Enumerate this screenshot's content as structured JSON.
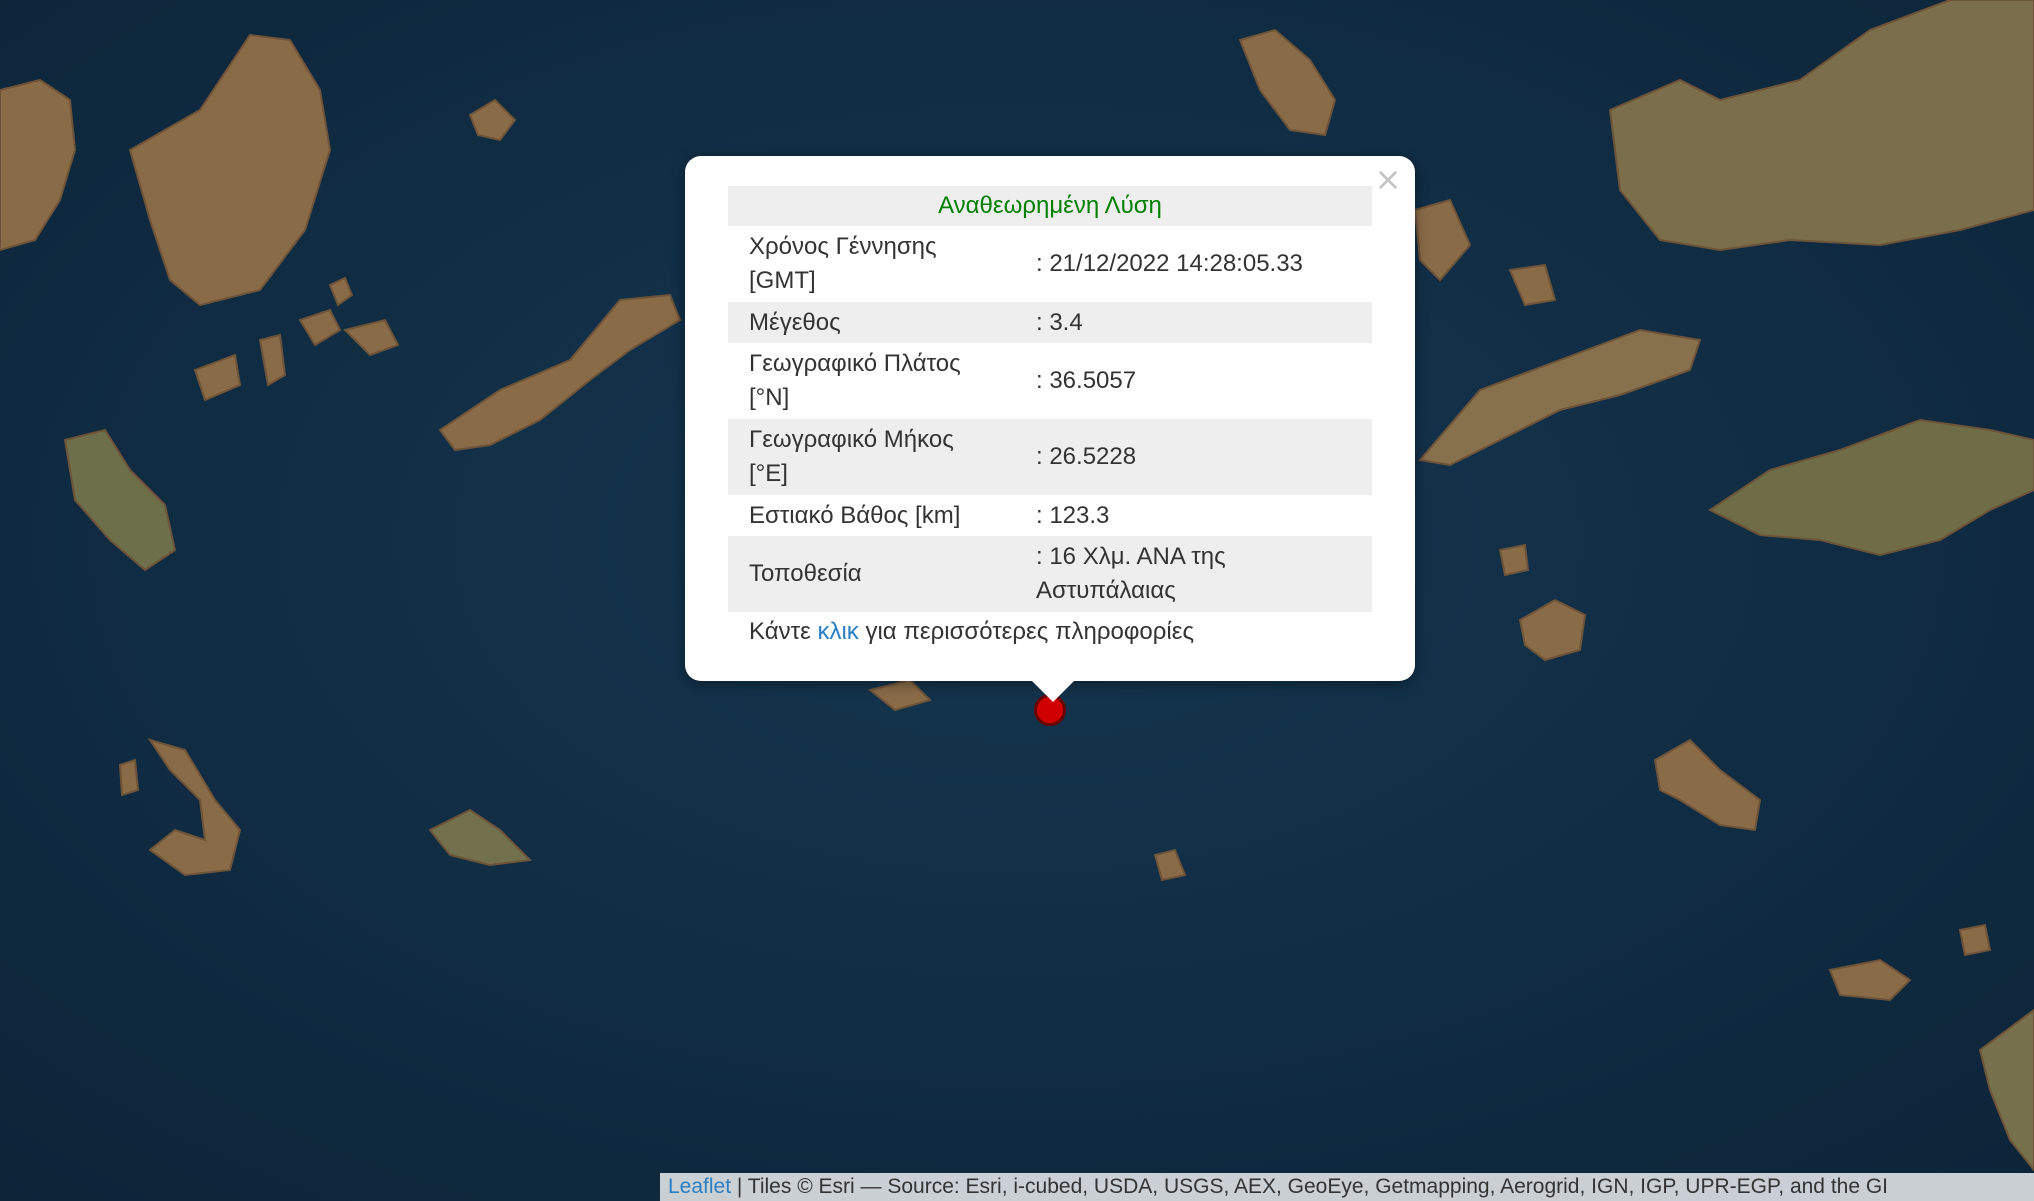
{
  "popup": {
    "close_symbol": "×",
    "title": "Αναθεωρημένη Λύση",
    "title_color": "#008000",
    "rows": [
      {
        "label": "Χρόνος Γέννησης [GMT]",
        "value": ": 21/12/2022 14:28:05.33"
      },
      {
        "label": "Μέγεθος",
        "value": ": 3.4"
      },
      {
        "label": "Γεωγραφικό Πλάτος [°N]",
        "value": ": 36.5057"
      },
      {
        "label": "Γεωγραφικό Μήκος [°E]",
        "value": ": 26.5228"
      },
      {
        "label": "Εστιακό Βάθος [km]",
        "value": ": 123.3"
      },
      {
        "label": "Τοποθεσία",
        "value": ": 16 Χλμ. ΑΝΑ της Αστυπάλαιας"
      }
    ],
    "more_prefix": "Κάντε ",
    "more_link": "κλικ",
    "more_suffix": " για περισσότερες πληροφορίες"
  },
  "marker": {
    "color": "#d10000"
  },
  "attribution": {
    "leaflet_link": "Leaflet",
    "text": " | Tiles © Esri — Source: Esri, i-cubed, USDA, USGS, AEX, GeoEye, Getmapping, Aerogrid, IGN, IGP, UPR-EGP, and the GI"
  },
  "colors": {
    "sea": "#12304a",
    "land": "#8a6c4a",
    "link": "#2a7fc4"
  }
}
